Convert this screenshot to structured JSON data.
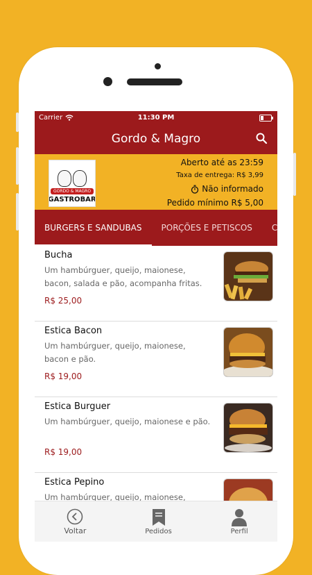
{
  "status_bar": {
    "carrier": "Carrier",
    "time": "11:30 PM"
  },
  "app_bar": {
    "title": "Gordo & Magro",
    "search_icon": "search-icon"
  },
  "restaurant": {
    "logo": {
      "ribbon_text": "GORDO & MAGRO",
      "name_text": "GASTROBAR"
    },
    "open_until": "Aberto até as 23:59",
    "delivery_fee": "Taxa de entrega: R$ 3,99",
    "time_icon": "stopwatch-icon",
    "delivery_time": "Não informado",
    "min_order": "Pedido mínimo R$ 5,00"
  },
  "tabs": [
    {
      "label": "BURGERS E SANDUBAS",
      "active": true
    },
    {
      "label": "PORÇÕES E PETISCOS",
      "active": false
    },
    {
      "label": "COM",
      "active": false
    }
  ],
  "items": [
    {
      "name": "Bucha",
      "description": "Um hambúrguer, queijo, maionese, bacon, salada e pão, acompanha fritas.",
      "price": "R$ 25,00"
    },
    {
      "name": "Estica Bacon",
      "description": "Um hambúrguer, queijo, maionese, bacon e pão.",
      "price": "R$ 19,00"
    },
    {
      "name": "Estica Burguer",
      "description": "Um hambúrguer, queijo, maionese e pão.",
      "price": "R$ 19,00"
    },
    {
      "name": "Estica Pepino",
      "description": "Um hambúrguer, queijo, maionese, pepino agridoce e pão.",
      "price": ""
    }
  ],
  "bottom_nav": [
    {
      "label": "Voltar",
      "icon": "back-circle-icon"
    },
    {
      "label": "Pedidos",
      "icon": "bookmark-icon"
    },
    {
      "label": "Perfil",
      "icon": "user-icon"
    }
  ],
  "colors": {
    "brand_red": "#9c1a1c",
    "brand_yellow": "#F2B225"
  }
}
